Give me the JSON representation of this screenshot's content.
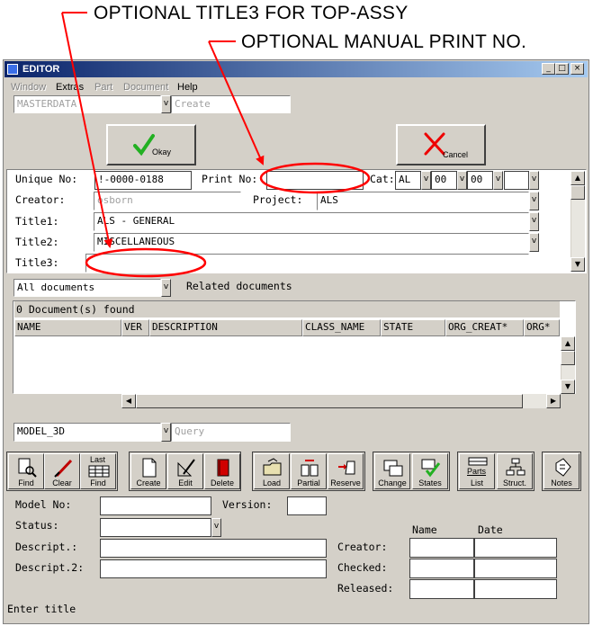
{
  "annotations": {
    "title3": "OPTIONAL TITLE3 FOR TOP-ASSY",
    "print_no": "OPTIONAL MANUAL PRINT NO."
  },
  "window": {
    "title": "EDITOR",
    "controls": {
      "minimize": "_",
      "maximize": "□",
      "close": "×"
    }
  },
  "menu": {
    "items": [
      {
        "label": "Window",
        "enabled": false
      },
      {
        "label": "Extras",
        "enabled": true
      },
      {
        "label": "Part",
        "enabled": false
      },
      {
        "label": "Document",
        "enabled": false
      },
      {
        "label": "Help",
        "enabled": true
      }
    ]
  },
  "top": {
    "class_value": "MASTERDATA",
    "mode_value": "Create"
  },
  "buttons": {
    "okay": "Okay",
    "cancel": "Cancel"
  },
  "form": {
    "unique_no_label": "Unique No:",
    "unique_no_value": "!-0000-0188",
    "print_no_label": "Print No:",
    "print_no_value": "",
    "cat_label": "Cat:",
    "cat_value": "AL",
    "cat2_value": "00",
    "cat3_value": "00",
    "cat4_value": "",
    "creator_label": "Creator:",
    "creator_value": "osborn",
    "project_label": "Project:",
    "project_value": "ALS",
    "title1_label": "Title1:",
    "title1_value": "ALS - GENERAL",
    "title2_label": "Title2:",
    "title2_value": "MISCELLANEOUS",
    "title3_label": "Title3:",
    "title3_value": ""
  },
  "related": {
    "filter_value": "All documents",
    "label": "Related documents",
    "found": "0 Document(s) found",
    "columns": [
      "NAME",
      "VER",
      "DESCRIPTION",
      "CLASS_NAME",
      "STATE",
      "ORG_CREAT*",
      "ORG*"
    ]
  },
  "model": {
    "class_value": "MODEL_3D",
    "mode_value": "Query"
  },
  "toolbar": [
    {
      "label": "Find",
      "icon": "find-icon"
    },
    {
      "label": "Clear",
      "icon": "eraser-icon"
    },
    {
      "label": "Last\nFind",
      "icon": "last-find-icon"
    },
    {
      "label": "Create",
      "icon": "new-document-icon"
    },
    {
      "label": "Edit",
      "icon": "edit-icon"
    },
    {
      "label": "Delete",
      "icon": "delete-icon"
    },
    {
      "label": "Load",
      "icon": "folder-open-icon"
    },
    {
      "label": "Partial",
      "icon": "partial-icon"
    },
    {
      "label": "Reserve",
      "icon": "reserve-icon"
    },
    {
      "label": "Change",
      "icon": "change-icon"
    },
    {
      "label": "States",
      "icon": "states-icon"
    },
    {
      "label": "List",
      "icon": "parts-list-icon",
      "top": "Parts"
    },
    {
      "label": "Struct.",
      "icon": "structure-icon"
    },
    {
      "label": "Notes",
      "icon": "notes-icon"
    }
  ],
  "bottom": {
    "model_no_label": "Model No:",
    "version_label": "Version:",
    "status_label": "Status:",
    "descript_label": "Descript.:",
    "descript2_label": "Descript.2:",
    "name_header": "Name",
    "date_header": "Date",
    "creator_label": "Creator:",
    "checked_label": "Checked:",
    "released_label": "Released:"
  },
  "statusbar": "Enter title",
  "colors": {
    "titlebar_start": "#0a246a",
    "titlebar_end": "#a6caf0",
    "annotation_red": "#ff0000",
    "okay_check": "#22b022",
    "cancel_x": "#ee0000"
  }
}
